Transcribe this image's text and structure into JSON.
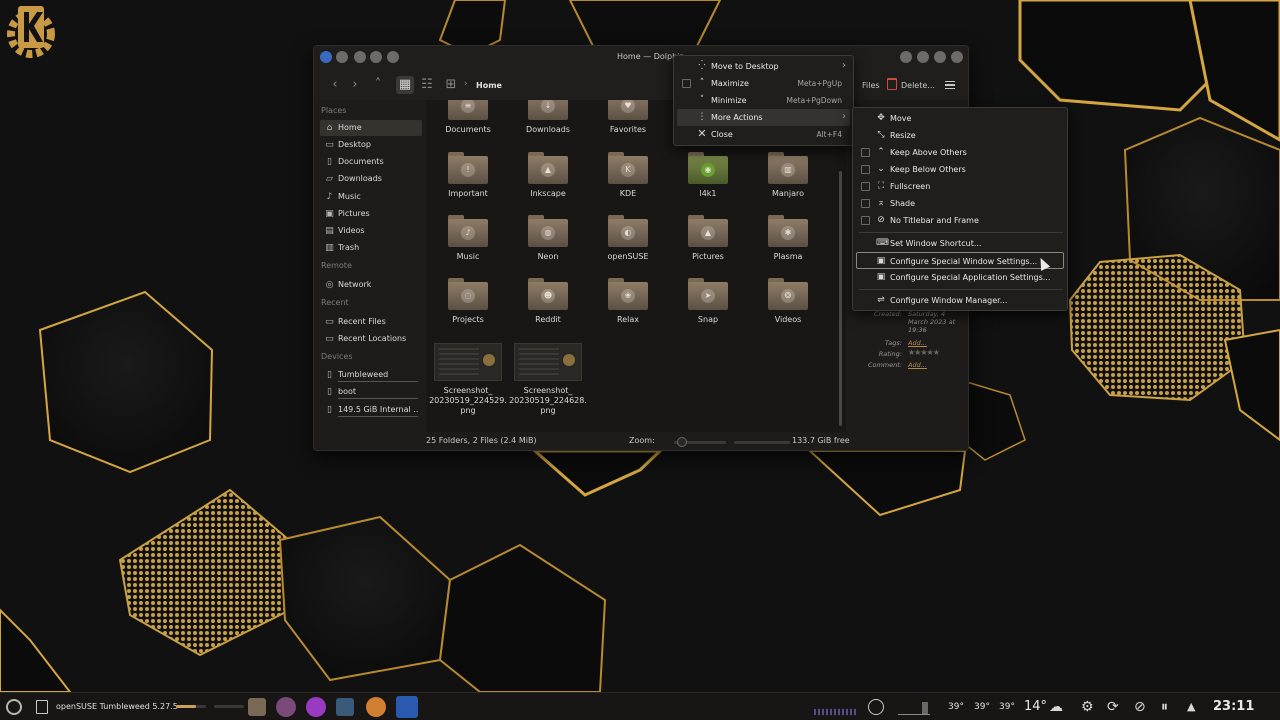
{
  "colors": {
    "accent_gold": "#d4a640",
    "menu_bg": "#1f1e1c",
    "window_bg": "#1d1c1b"
  },
  "window": {
    "title": "Home — Dolphin",
    "breadcrumb": "Home",
    "toolbar_files": "Files",
    "toolbar_delete": "Delete..."
  },
  "sidebar": {
    "places_heading": "Places",
    "places": [
      {
        "label": "Home",
        "icon": "home-icon"
      },
      {
        "label": "Desktop",
        "icon": "desktop-icon"
      },
      {
        "label": "Documents",
        "icon": "documents-icon"
      },
      {
        "label": "Downloads",
        "icon": "downloads-icon"
      },
      {
        "label": "Music",
        "icon": "music-icon"
      },
      {
        "label": "Pictures",
        "icon": "pictures-icon"
      },
      {
        "label": "Videos",
        "icon": "videos-icon"
      },
      {
        "label": "Trash",
        "icon": "trash-icon"
      }
    ],
    "remote_heading": "Remote",
    "remote": [
      {
        "label": "Network",
        "icon": "network-icon"
      }
    ],
    "recent_heading": "Recent",
    "recent": [
      {
        "label": "Recent Files",
        "icon": "recent-files-icon"
      },
      {
        "label": "Recent Locations",
        "icon": "recent-locations-icon"
      }
    ],
    "devices_heading": "Devices",
    "devices": [
      {
        "label": "Tumbleweed",
        "icon": "drive-icon"
      },
      {
        "label": "boot",
        "icon": "drive-icon"
      },
      {
        "label": "149.5 GiB Internal ...",
        "icon": "drive-icon"
      }
    ]
  },
  "files": {
    "row0": [
      "Documents",
      "Downloads",
      "Favorites"
    ],
    "row1": [
      "Important",
      "Inkscape",
      "KDE",
      "l4k1",
      "Manjaro"
    ],
    "row2": [
      "Music",
      "Neon",
      "openSUSE",
      "Pictures",
      "Plasma"
    ],
    "row3": [
      "Projects",
      "Reddit",
      "Relax",
      "Snap",
      "Videos"
    ],
    "images": [
      {
        "line1": "Screenshot_",
        "line2": "20230519_224529.",
        "line3": "png"
      },
      {
        "line1": "Screenshot_",
        "line2": "20230519_224628.",
        "line3": "png"
      }
    ]
  },
  "status": {
    "summary": "25 Folders, 2 Files (2.4 MiB)",
    "zoom_label": "Zoom:",
    "free_space": "133.7 GiB free",
    "zoom_level": 0.1,
    "used_space_fraction": 0.88
  },
  "info_panel": {
    "created_label": "Created:",
    "created_value_1": "Saturday, 4",
    "created_value_2": "March 2023 at",
    "created_value_3": "19:36",
    "tags_label": "Tags:",
    "tags_value": "Add...",
    "rating_label": "Rating:",
    "rating_value": "0",
    "comment_label": "Comment:",
    "comment_value": "Add..."
  },
  "window_menu": [
    {
      "label": "Move to Desktop",
      "shortcut": "",
      "submenu": true
    },
    {
      "label": "Maximize",
      "shortcut": "Meta+PgUp",
      "checkbox": true
    },
    {
      "label": "Minimize",
      "shortcut": "Meta+PgDown"
    },
    {
      "label": "More Actions",
      "shortcut": "",
      "submenu": true
    },
    {
      "label": "Close",
      "shortcut": "Alt+F4"
    }
  ],
  "more_actions_menu": [
    {
      "label": "Move"
    },
    {
      "label": "Resize"
    },
    {
      "label": "Keep Above Others"
    },
    {
      "label": "Keep Below Others"
    },
    {
      "label": "Fullscreen"
    },
    {
      "label": "Shade"
    },
    {
      "label": "No Titlebar and Frame"
    },
    {
      "label": "Set Window Shortcut..."
    },
    {
      "label": "Configure Special Window Settings..."
    },
    {
      "label": "Configure Special Application Settings..."
    },
    {
      "label": "Configure Window Manager..."
    }
  ],
  "taskbar": {
    "task_label": "openSUSE Tumbleweed 5.27.5",
    "temps": [
      "39°",
      "39°",
      "39°"
    ],
    "weather": "14°",
    "clock": "23:11"
  }
}
